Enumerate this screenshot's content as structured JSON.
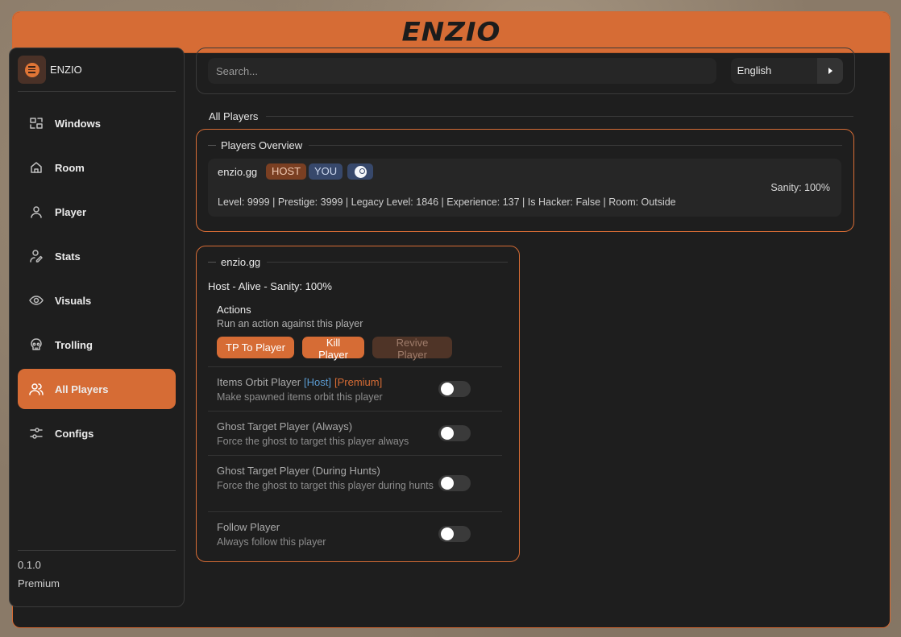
{
  "app": {
    "logo": "ENZIO",
    "name": "ENZIO",
    "version": "0.1.0",
    "tier": "Premium"
  },
  "sidebar": {
    "items": [
      {
        "label": "Windows",
        "icon": "windows-icon",
        "active": false
      },
      {
        "label": "Room",
        "icon": "home-icon",
        "active": false
      },
      {
        "label": "Player",
        "icon": "user-icon",
        "active": false
      },
      {
        "label": "Stats",
        "icon": "user-edit-icon",
        "active": false
      },
      {
        "label": "Visuals",
        "icon": "eye-icon",
        "active": false
      },
      {
        "label": "Trolling",
        "icon": "skull-icon",
        "active": false
      },
      {
        "label": "All Players",
        "icon": "users-icon",
        "active": true
      },
      {
        "label": "Configs",
        "icon": "sliders-icon",
        "active": false
      }
    ]
  },
  "search": {
    "placeholder": "Search...",
    "value": ""
  },
  "language": {
    "selected": "English"
  },
  "section": {
    "title": "All Players"
  },
  "overview": {
    "title": "Players Overview",
    "player": {
      "name": "enzio.gg",
      "badges": {
        "host": "HOST",
        "you": "YOU"
      },
      "sanity": "Sanity: 100%",
      "stats": "Level: 9999 | Prestige: 3999 | Legacy Level: 1846 | Experience: 137 | Is Hacker: False | Room: Outside"
    }
  },
  "detail": {
    "title": "enzio.gg",
    "status": "Host - Alive - Sanity: 100%",
    "actions": {
      "title": "Actions",
      "subtitle": "Run an action against this player",
      "tp": "TP To Player",
      "kill": "Kill Player",
      "revive": "Revive Player"
    },
    "options": [
      {
        "title": "Items Orbit Player",
        "tag_host": "[Host]",
        "tag_premium": "[Premium]",
        "desc": "Make spawned items orbit this player",
        "enabled": false
      },
      {
        "title": "Ghost Target Player (Always)",
        "desc": "Force the ghost to target this player always",
        "enabled": false
      },
      {
        "title": "Ghost Target Player (During Hunts)",
        "desc": "Force the ghost to target this player during hunts",
        "enabled": false
      },
      {
        "title": "Follow Player",
        "desc": "Always follow this player",
        "enabled": false
      }
    ]
  },
  "colors": {
    "accent": "#d66c35",
    "background": "#1e1e1e",
    "host_tag": "#5a9ad0"
  }
}
